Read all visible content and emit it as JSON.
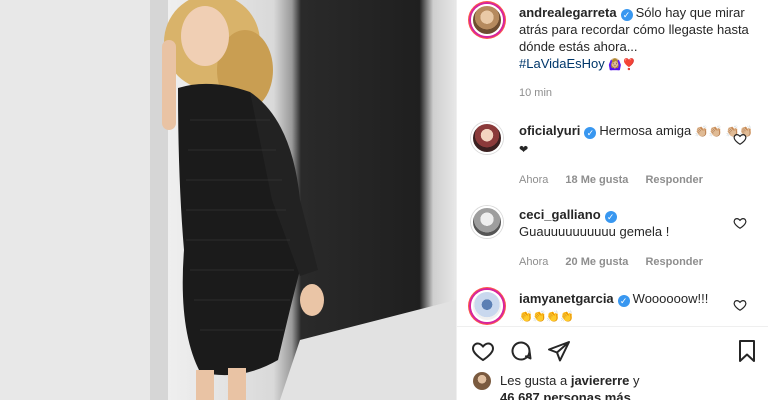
{
  "post": {
    "author": "andrealegarreta",
    "caption": "Sólo hay que mirar atrás para recordar cómo llegaste hasta dónde estás ahora...",
    "hashtag": "#LaVidaEsHoy",
    "caption_emoji": "🙆🏼‍♀️❣️",
    "time": "10 min"
  },
  "comments": [
    {
      "user": "oficialyuri",
      "text": "Hermosa amiga",
      "emoji": "👏🏼👏🏼 👏🏼👏🏼❤",
      "time": "Ahora",
      "likes": "18 Me gusta",
      "reply": "Responder"
    },
    {
      "user": "ceci_galliano",
      "text": "Guauuuuuuuuuu gemela !",
      "time": "Ahora",
      "likes": "20 Me gusta",
      "reply": "Responder"
    },
    {
      "user": "iamyanetgarcia",
      "text": "Woooooow!!!",
      "emoji": "👏👏👏👏"
    }
  ],
  "likes_summary": {
    "prefix": "Les gusta a",
    "user": "javiererre",
    "suffix": "y",
    "count": "46.687 personas más"
  },
  "icons": [
    "heart-icon",
    "comment-icon",
    "share-icon",
    "bookmark-icon",
    "verified-icon"
  ],
  "colors": {
    "verified": "#3897f0",
    "hashtag": "#00376b",
    "meta": "#8e8e8e"
  }
}
